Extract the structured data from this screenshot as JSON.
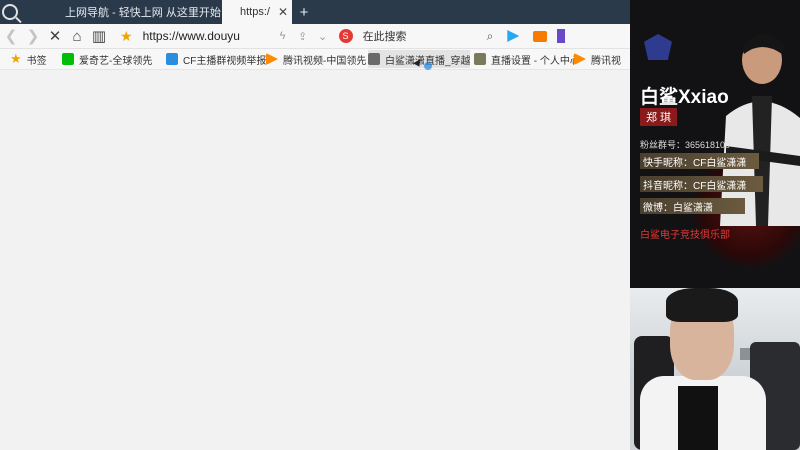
{
  "browser": {
    "brand_text": "Q",
    "tabs": [
      {
        "label": "上网导航 - 轻快上网 从这里开始"
      },
      {
        "label": "https:/",
        "close": "✕"
      }
    ],
    "new_tab": "+",
    "address": {
      "url": "https://www.douyu"
    },
    "search": {
      "engine_glyph": "S",
      "placeholder": "在此搜索"
    },
    "bookmarks": [
      {
        "label": "书签",
        "color": "#f0a400"
      },
      {
        "label": "爱奇艺-全球领先",
        "color": "#00be06"
      },
      {
        "label": "CF主播群视频举报",
        "color": "#2a8de0"
      },
      {
        "label": "腾讯视频-中国领先",
        "color": "#ff8a00"
      },
      {
        "label": "白鲨潇潇直播_穿越",
        "color": "#6a6a6a"
      },
      {
        "label": "直播设置 - 个人中心",
        "color": "#7a7a5a"
      },
      {
        "label": "腾讯视",
        "color": "#ff8a00"
      }
    ]
  },
  "streamer_card": {
    "name": "白鲨Xxiao",
    "real_name": "郑 琪",
    "fan_group": "粉丝群号：365618100",
    "kuaishou": "快手昵称：CF白鲨潇潇",
    "douyin": "抖音昵称：CF白鲨潇潇",
    "weibo": "微博：白鲨潇潇",
    "club": "白鲨电子竞技俱乐部"
  }
}
